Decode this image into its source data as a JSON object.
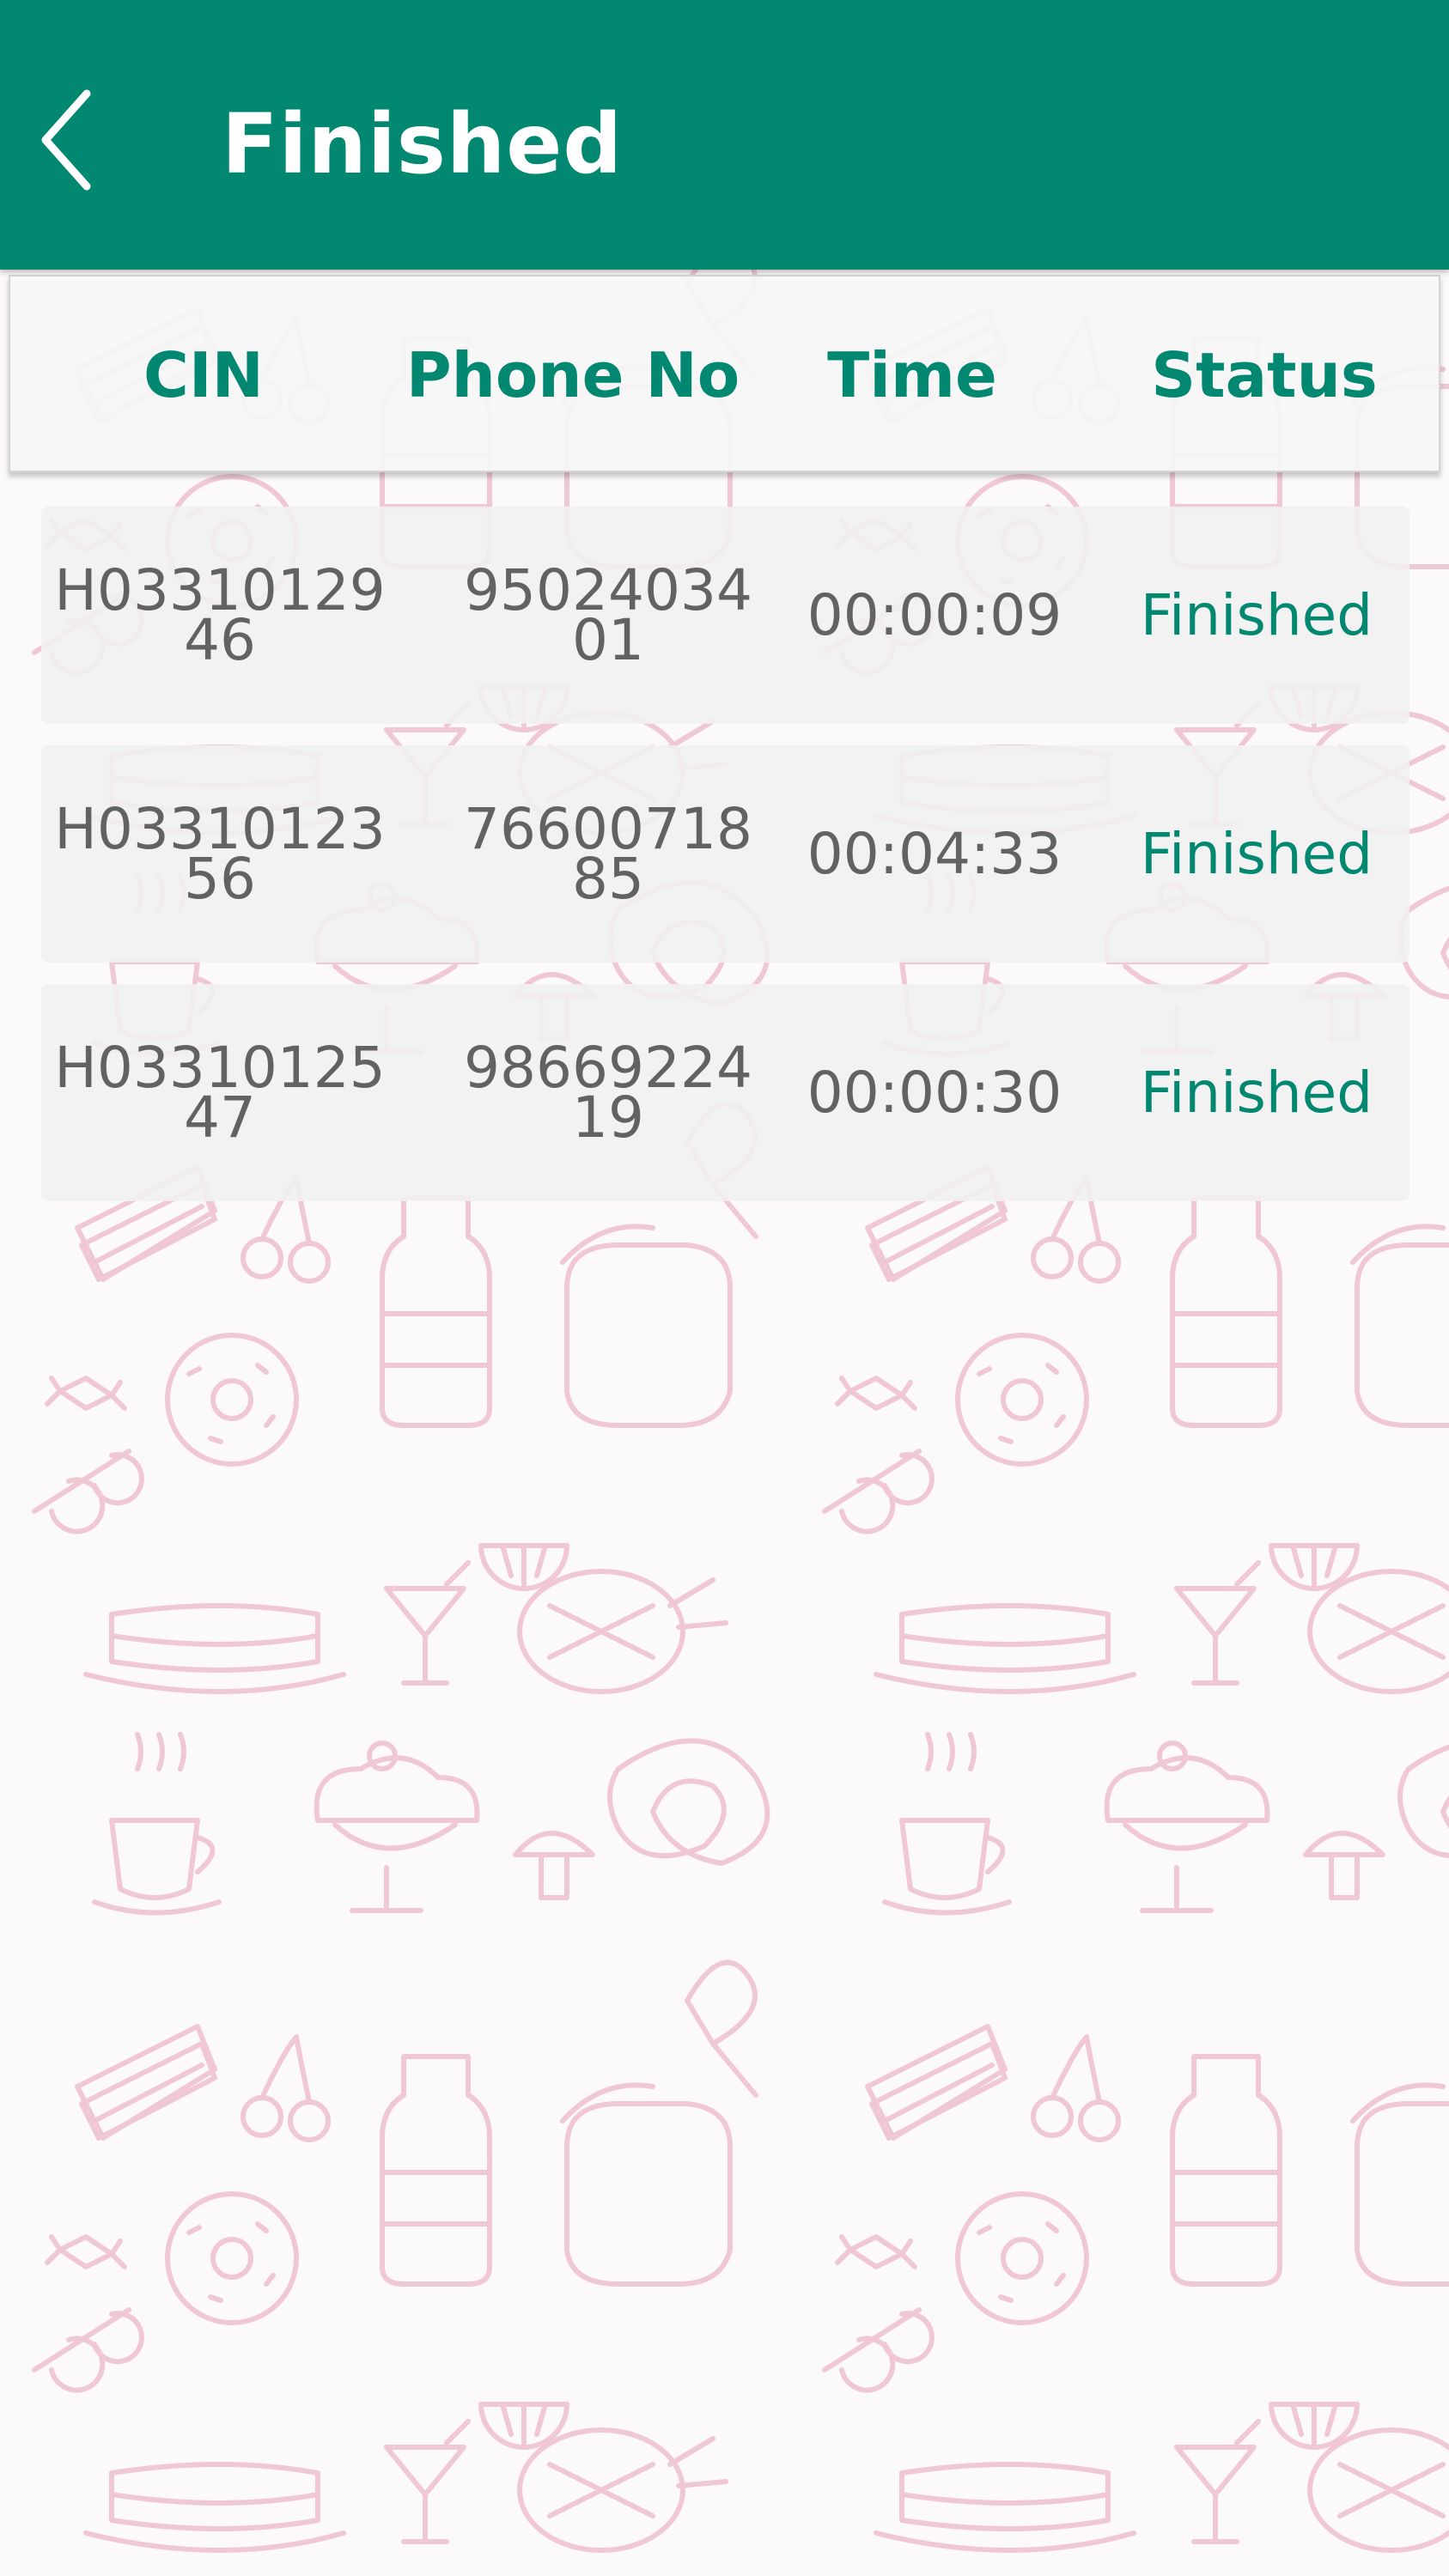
{
  "appbar": {
    "title": "Finished",
    "back_icon": "chevron-left-icon"
  },
  "colors": {
    "primary": "#028770",
    "text_gray": "#626262",
    "pattern_pink": "#f0c8d3"
  },
  "table": {
    "headers": [
      "CIN",
      "Phone No",
      "Time",
      "Status"
    ],
    "rows": [
      {
        "cin_1": "H03310129",
        "cin_2": "46",
        "phone_1": "95024034",
        "phone_2": "01",
        "time": "00:00:09",
        "status": "Finished"
      },
      {
        "cin_1": "H03310123",
        "cin_2": "56",
        "phone_1": "76600718",
        "phone_2": "85",
        "time": "00:04:33",
        "status": "Finished"
      },
      {
        "cin_1": "H03310125",
        "cin_2": "47",
        "phone_1": "98669224",
        "phone_2": "19",
        "time": "00:00:30",
        "status": "Finished"
      }
    ]
  }
}
